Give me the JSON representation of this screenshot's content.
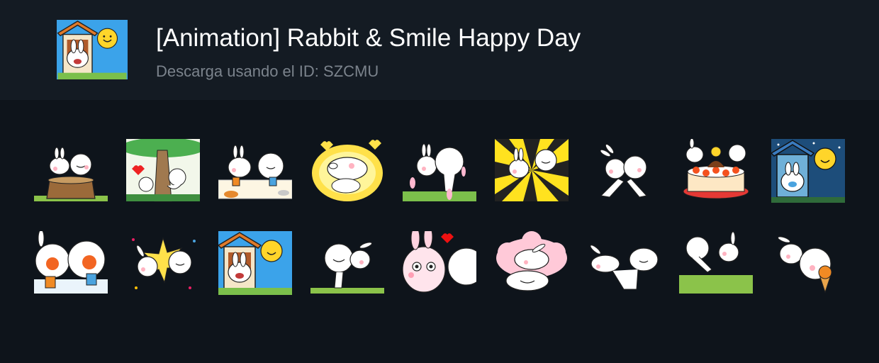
{
  "header": {
    "title": "[Animation] Rabbit & Smile Happy Day",
    "subtitle": "Descarga usando el ID: SZCMU",
    "icon": "rabbit-house-sun-icon"
  },
  "stickers": [
    {
      "id": "s1",
      "icon": "rabbit-smile-stump-icon"
    },
    {
      "id": "s2",
      "icon": "rabbit-smile-tree-icon"
    },
    {
      "id": "s3",
      "icon": "rabbit-smile-drinks-icon"
    },
    {
      "id": "s4",
      "icon": "rabbit-smile-hug-yellow-icon"
    },
    {
      "id": "s5",
      "icon": "rabbit-smile-kiss-icon"
    },
    {
      "id": "s6",
      "icon": "rabbit-smile-sunburst-icon"
    },
    {
      "id": "s7",
      "icon": "rabbit-smile-dance-icon"
    },
    {
      "id": "s8",
      "icon": "rabbit-smile-cake-icon"
    },
    {
      "id": "s9",
      "icon": "rabbit-house-moon-icon"
    },
    {
      "id": "s10",
      "icon": "rabbit-smile-blush-mugs-icon"
    },
    {
      "id": "s11",
      "icon": "rabbit-smile-high-five-icon"
    },
    {
      "id": "s12",
      "icon": "rabbit-house-sun-icon"
    },
    {
      "id": "s13",
      "icon": "smile-carry-rabbit-icon"
    },
    {
      "id": "s14",
      "icon": "rabbit-heart-kiss-icon"
    },
    {
      "id": "s15",
      "icon": "rabbit-smile-pink-cloud-icon"
    },
    {
      "id": "s16",
      "icon": "rabbit-smile-lean-icon"
    },
    {
      "id": "s17",
      "icon": "smile-rabbit-kiss-grass-icon"
    },
    {
      "id": "s18",
      "icon": "rabbit-smile-icecream-icon"
    }
  ]
}
